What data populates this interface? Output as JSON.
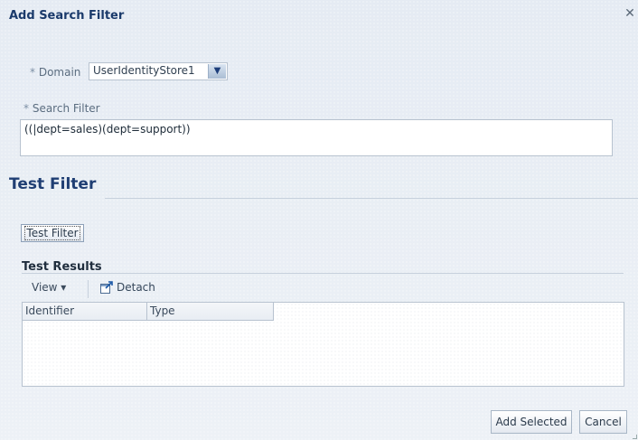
{
  "dialog": {
    "title": "Add Search Filter",
    "close_icon": "close-icon"
  },
  "form": {
    "required_marker": "*",
    "domain_label": "Domain",
    "domain_value": "UserIdentityStore1",
    "domain_arrow": "▼",
    "search_filter_label": "Search Filter",
    "search_filter_value": "((|dept=sales)(dept=support))"
  },
  "test_section": {
    "title": "Test Filter",
    "test_button": "Test Filter"
  },
  "results": {
    "title": "Test Results",
    "view_menu": "View ▾",
    "detach_label": "Detach",
    "detach_icon": "detach-icon",
    "columns": [
      "Identifier",
      "Type"
    ],
    "rows": []
  },
  "footer": {
    "add_selected": "Add Selected",
    "cancel": "Cancel"
  },
  "colors": {
    "title": "#1a3a6b",
    "section_title": "#1f3e73",
    "background": "#e7ecf4"
  }
}
